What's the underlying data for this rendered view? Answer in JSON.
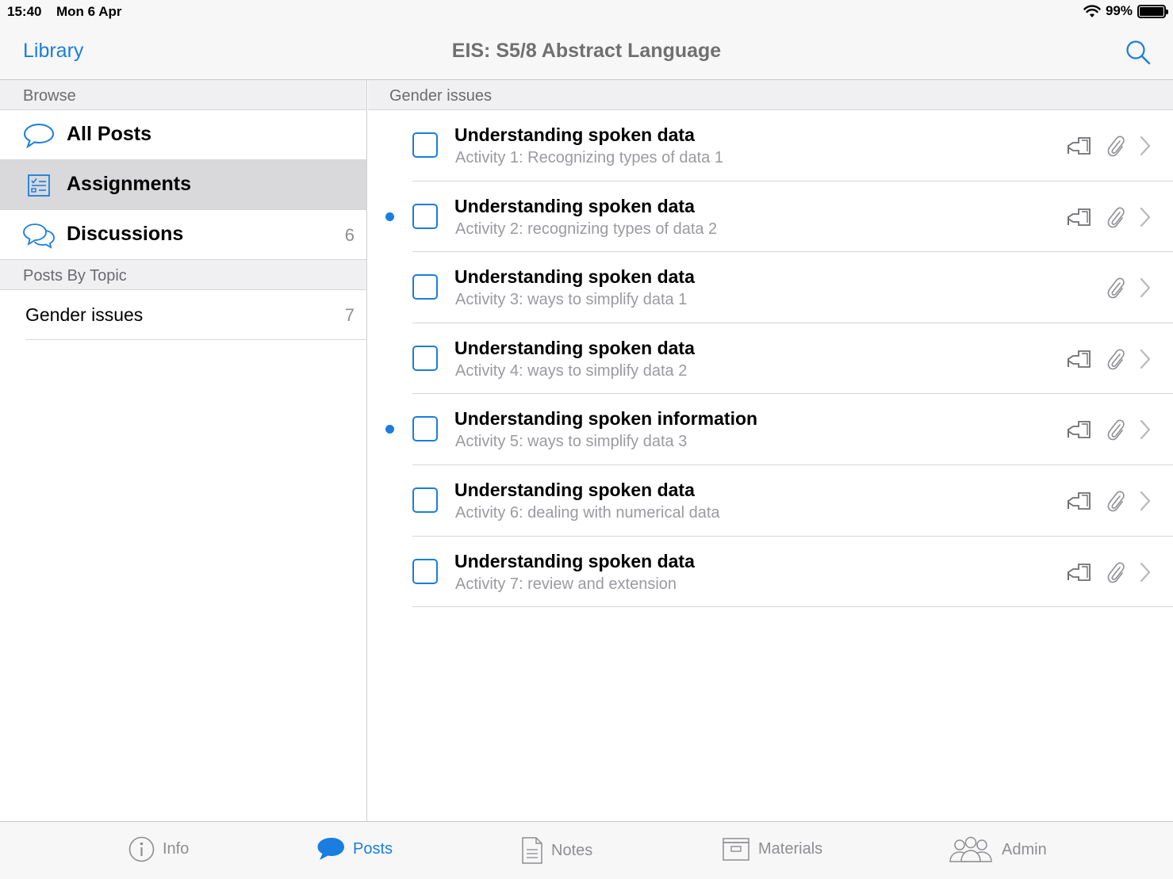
{
  "status_bar": {
    "time": "15:40",
    "date": "Mon 6 Apr",
    "battery": "99%"
  },
  "nav": {
    "back_label": "Library",
    "title": "EIS: S5/8 Abstract Language"
  },
  "left": {
    "browse_header": "Browse",
    "items": [
      {
        "label": "All Posts",
        "icon": "speech-bubble-icon",
        "count": ""
      },
      {
        "label": "Assignments",
        "icon": "checklist-icon",
        "count": ""
      },
      {
        "label": "Discussions",
        "icon": "discussion-bubbles-icon",
        "count": "6"
      }
    ],
    "topics_header": "Posts By Topic",
    "topics": [
      {
        "label": "Gender issues",
        "count": "7"
      }
    ]
  },
  "right": {
    "header": "Gender issues",
    "rows": [
      {
        "title": "Understanding spoken data",
        "subtitle": "Activity 1: Recognizing types of data 1",
        "unread": false,
        "handin": true
      },
      {
        "title": "Understanding spoken data",
        "subtitle": "Activity 2: recognizing types of data 2",
        "unread": true,
        "handin": true
      },
      {
        "title": "Understanding spoken data",
        "subtitle": "Activity 3: ways to simplify data 1",
        "unread": false,
        "handin": false
      },
      {
        "title": "Understanding spoken data",
        "subtitle": "Activity 4: ways to simplify data 2",
        "unread": false,
        "handin": true
      },
      {
        "title": "Understanding spoken information",
        "subtitle": "Activity 5: ways to simplify data 3",
        "unread": true,
        "handin": true
      },
      {
        "title": "Understanding spoken data",
        "subtitle": "Activity 6: dealing with numerical data",
        "unread": false,
        "handin": true
      },
      {
        "title": "Understanding spoken data",
        "subtitle": "Activity 7: review and extension",
        "unread": false,
        "handin": true
      }
    ]
  },
  "tabs": [
    {
      "label": "Info",
      "icon": "info-icon",
      "active": false
    },
    {
      "label": "Posts",
      "icon": "posts-bubble-icon",
      "active": true
    },
    {
      "label": "Notes",
      "icon": "notes-icon",
      "active": false
    },
    {
      "label": "Materials",
      "icon": "materials-box-icon",
      "active": false
    },
    {
      "label": "Admin",
      "icon": "admin-people-icon",
      "active": false
    }
  ],
  "colors": {
    "accent": "#1a7de0",
    "selected_row": "#d9d9db",
    "section_header": "#f0f0f2"
  }
}
